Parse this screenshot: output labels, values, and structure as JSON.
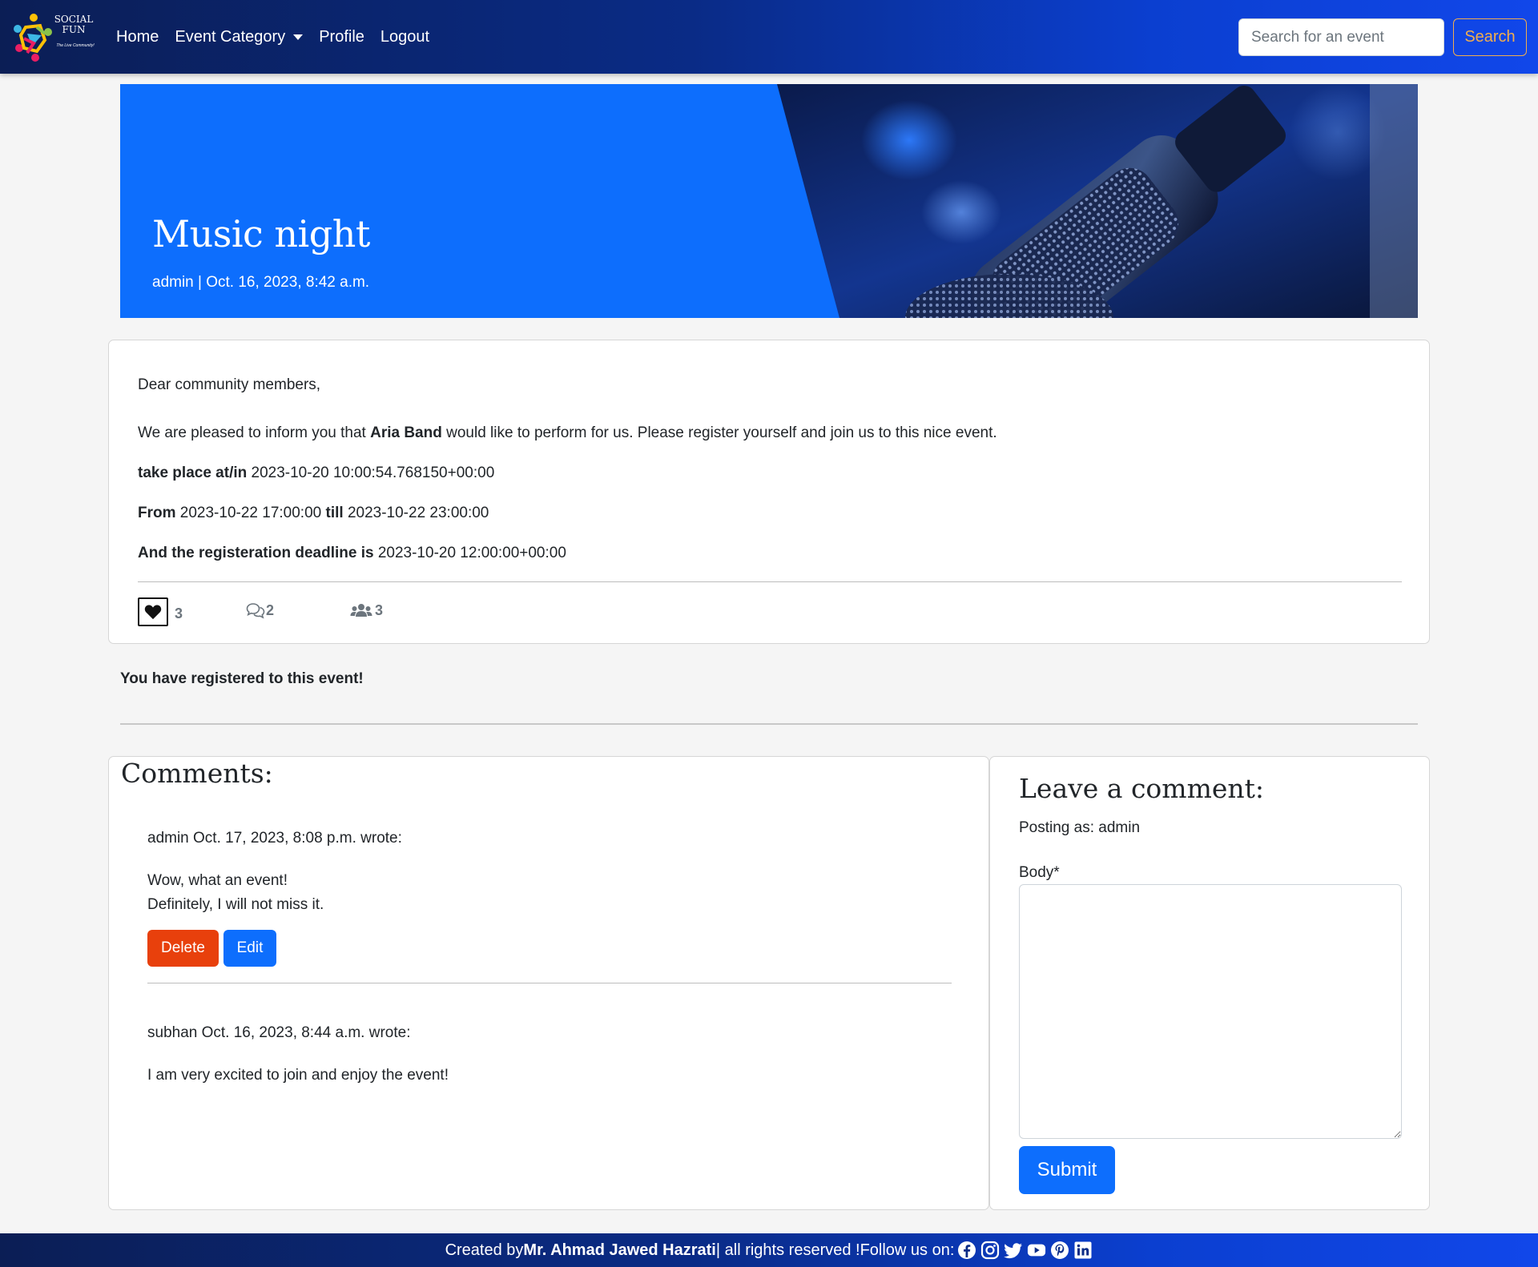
{
  "brand": {
    "name_line1": "SOCIAL",
    "name_line2": "FUN",
    "tagline": "The Live Community!"
  },
  "nav": {
    "items": [
      {
        "label": "Home"
      },
      {
        "label": "Event Category"
      },
      {
        "label": "Profile"
      },
      {
        "label": "Logout"
      }
    ],
    "search_placeholder": "Search for an event",
    "search_button": "Search"
  },
  "event": {
    "title": "Music night",
    "meta": "admin | Oct. 16, 2023, 8:42 a.m.",
    "greeting": "Dear community members,",
    "intro_before": "We are pleased to inform you that ",
    "intro_bold": "Aria Band",
    "intro_after": " would like to perform for us. Please register yourself and join us to this nice event.",
    "place_label": "take place at/in",
    "place_value": " 2023-10-20 10:00:54.768150+00:00",
    "from_label": "From",
    "from_value": " 2023-10-22 17:00:00 ",
    "till_label": "till",
    "till_value": " 2023-10-22 23:00:00",
    "deadline_label": "And the registeration deadline is",
    "deadline_value": " 2023-10-20 12:00:00+00:00",
    "likes": "3",
    "comments_count": "2",
    "attendees": "3",
    "registered_message": "You have registered to this event!"
  },
  "comments": {
    "title": "Comments:",
    "items": [
      {
        "meta": "admin Oct. 17, 2023, 8:08 p.m. wrote:",
        "line1": "Wow, what an event!",
        "line2": "Definitely, I will not miss it.",
        "delete_label": "Delete",
        "edit_label": "Edit"
      },
      {
        "meta": "subhan Oct. 16, 2023, 8:44 a.m. wrote:",
        "line1": "I am very excited to join and enjoy the event!"
      }
    ]
  },
  "comment_form": {
    "title": "Leave a comment:",
    "posting_as": "Posting as: admin",
    "body_label": "Body*",
    "body_value": "",
    "submit_label": "Submit"
  },
  "footer": {
    "prefix": "Created by ",
    "author": "Mr. Ahmad Jawed Hazrati",
    "suffix": " | all rights reserved !Follow us on: ",
    "social_icons": [
      "facebook-icon",
      "instagram-icon",
      "twitter-icon",
      "youtube-icon",
      "pinterest-icon",
      "linkedin-icon"
    ]
  },
  "colors": {
    "primary": "#0d6efd",
    "danger": "#e8400c",
    "navbar_dark": "#0b1e55",
    "navbar_light": "#1147ea",
    "search_accent": "#f0ad4e"
  }
}
